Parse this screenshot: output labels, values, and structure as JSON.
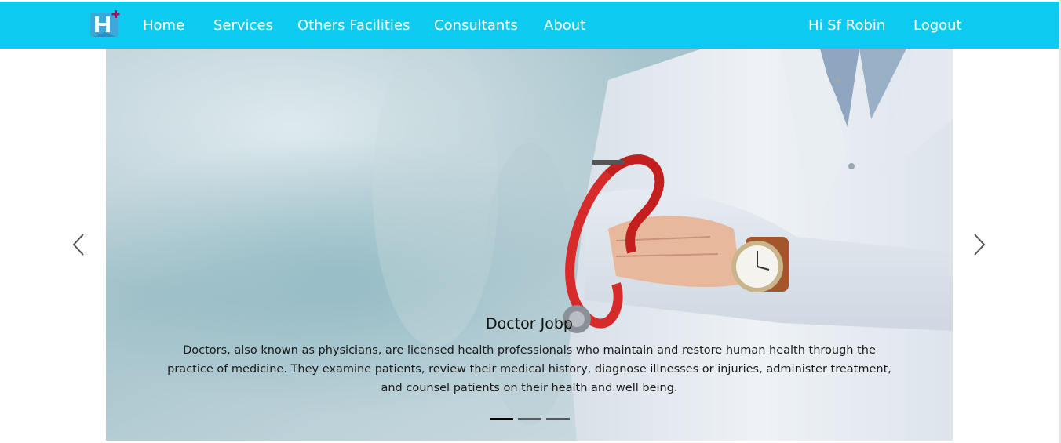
{
  "navbar": {
    "brand_letter": "H",
    "links": [
      {
        "label": "Home"
      },
      {
        "label": "Services"
      },
      {
        "label": "Others Facilities"
      },
      {
        "label": "Consultants"
      },
      {
        "label": "About"
      }
    ],
    "greeting": "Hi Sf Robin",
    "logout_label": "Logout",
    "color": "#0dcaf0"
  },
  "carousel": {
    "active_slide": 1,
    "slide_count": 3,
    "slide": {
      "title": "Doctor Jobp",
      "text": "Doctors, also known as physicians, are licensed health professionals who maintain and restore human health through the practice of medicine. They examine patients, review their medical history, diagnose illnesses or injuries, administer treatment, and counsel patients on their health and well being."
    },
    "prev_icon": "chevron-left-icon",
    "next_icon": "chevron-right-icon"
  }
}
